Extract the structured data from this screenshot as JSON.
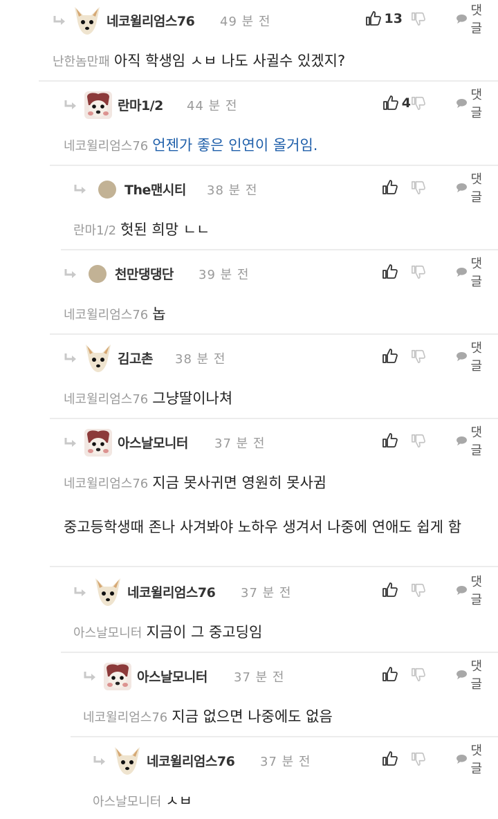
{
  "thread": {
    "reply_label": "댓글",
    "comments": [
      {
        "nickname": "네코윌리엄스76",
        "time": "49 분 전",
        "likes": "13",
        "mention": "난한놈만패",
        "text": "아직 학생임 ㅅㅂ 나도 사귈수 있겠지?",
        "avatar": "dog-avatar"
      },
      {
        "nickname": "란마1/2",
        "time": "44 분 전",
        "likes": "4",
        "mention": "네코윌리엄스76",
        "text": "언젠가 좋은 인연이 올거임.",
        "avatar": "dog-face-avatar"
      },
      {
        "nickname": "The맨시티",
        "time": "38 분 전",
        "likes": "",
        "mention": "란마1/2",
        "text": "헛된 희망 ㄴㄴ",
        "avatar": "default-avatar"
      },
      {
        "nickname": "천만댕댕단",
        "time": "39 분 전",
        "likes": "",
        "mention": "네코윌리엄스76",
        "text": "놉",
        "avatar": "default-avatar"
      },
      {
        "nickname": "김고촌",
        "time": "38 분 전",
        "likes": "",
        "mention": "네코윌리엄스76",
        "text": "그냥딸이나쳐",
        "avatar": "dog-avatar"
      },
      {
        "nickname": "아스날모니터",
        "time": "37 분 전",
        "likes": "",
        "mention": "네코윌리엄스76",
        "text": "지금 못사귀면 영원히 못사귐",
        "extra": "중고등학생때 존나 사겨봐야 노하우 생겨서 나중에 연애도 쉽게 함",
        "avatar": "dog-face-avatar"
      },
      {
        "nickname": "네코윌리엄스76",
        "time": "37 분 전",
        "likes": "",
        "mention": "아스날모니터",
        "text": "지금이 그 중고딩임",
        "avatar": "dog-avatar"
      },
      {
        "nickname": "아스날모니터",
        "time": "37 분 전",
        "likes": "",
        "mention": "네코윌리엄스76",
        "text": "지금 없으면 나중에도 없음",
        "avatar": "dog-face-avatar"
      },
      {
        "nickname": "네코윌리엄스76",
        "time": "37 분 전",
        "likes": "",
        "mention": "아스날모니터",
        "text": "ㅅㅂ",
        "avatar": "dog-avatar"
      }
    ]
  },
  "colors": {
    "link_text": "#1f5faa",
    "muted": "#9a9a9a",
    "separator": "#ececec",
    "default_avatar": "#c2b295"
  }
}
